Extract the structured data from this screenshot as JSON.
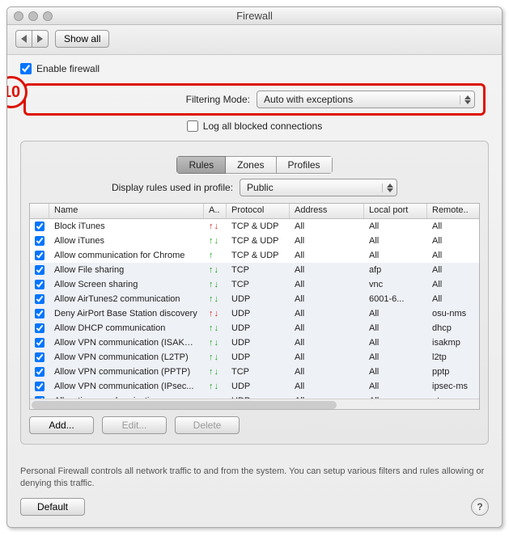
{
  "window": {
    "title": "Firewall"
  },
  "toolbar": {
    "show_all": "Show all"
  },
  "main": {
    "enable_label": "Enable firewall",
    "filtering_label": "Filtering Mode:",
    "filtering_value": "Auto with exceptions",
    "log_label": "Log all blocked connections",
    "annotation_number": "10"
  },
  "tabs": {
    "rules": "Rules",
    "zones": "Zones",
    "profiles": "Profiles"
  },
  "profile": {
    "label": "Display rules used in profile:",
    "value": "Public"
  },
  "columns": {
    "name": "Name",
    "action": "A..",
    "protocol": "Protocol",
    "address": "Address",
    "localport": "Local port",
    "remoteport": "Remote.."
  },
  "rows": [
    {
      "name": "Block iTunes",
      "action": "deny",
      "protocol": "TCP & UDP",
      "address": "All",
      "localport": "All",
      "remoteport": "All",
      "striped": false
    },
    {
      "name": "Allow iTunes",
      "action": "allow",
      "protocol": "TCP & UDP",
      "address": "All",
      "localport": "All",
      "remoteport": "All",
      "striped": false
    },
    {
      "name": "Allow communication for Chrome",
      "action": "allow-up",
      "protocol": "TCP & UDP",
      "address": "All",
      "localport": "All",
      "remoteport": "All",
      "striped": false
    },
    {
      "name": "Allow File sharing",
      "action": "allow",
      "protocol": "TCP",
      "address": "All",
      "localport": "afp",
      "remoteport": "All",
      "striped": true
    },
    {
      "name": "Allow Screen sharing",
      "action": "allow",
      "protocol": "TCP",
      "address": "All",
      "localport": "vnc",
      "remoteport": "All",
      "striped": true
    },
    {
      "name": "Allow AirTunes2 communication",
      "action": "allow",
      "protocol": "UDP",
      "address": "All",
      "localport": "6001-6...",
      "remoteport": "All",
      "striped": true
    },
    {
      "name": "Deny AirPort Base Station discovery",
      "action": "deny",
      "protocol": "UDP",
      "address": "All",
      "localport": "All",
      "remoteport": "osu-nms",
      "striped": true
    },
    {
      "name": "Allow DHCP communication",
      "action": "allow",
      "protocol": "UDP",
      "address": "All",
      "localport": "All",
      "remoteport": "dhcp",
      "striped": true
    },
    {
      "name": "Allow VPN communication (ISAKM...",
      "action": "allow",
      "protocol": "UDP",
      "address": "All",
      "localport": "All",
      "remoteport": "isakmp",
      "striped": true
    },
    {
      "name": "Allow VPN communication (L2TP)",
      "action": "allow",
      "protocol": "UDP",
      "address": "All",
      "localport": "All",
      "remoteport": "l2tp",
      "striped": true
    },
    {
      "name": "Allow VPN communication (PPTP)",
      "action": "allow",
      "protocol": "TCP",
      "address": "All",
      "localport": "All",
      "remoteport": "pptp",
      "striped": true
    },
    {
      "name": "Allow VPN communication (IPsec...",
      "action": "allow",
      "protocol": "UDP",
      "address": "All",
      "localport": "All",
      "remoteport": "ipsec-ms",
      "striped": true
    },
    {
      "name": "Allow time synchronization",
      "action": "allow",
      "protocol": "UDP",
      "address": "All",
      "localport": "All",
      "remoteport": "ntp",
      "striped": true
    }
  ],
  "actions": {
    "add": "Add...",
    "edit": "Edit...",
    "delete": "Delete"
  },
  "footer": {
    "text": "Personal Firewall controls all network traffic to and from the system. You can setup various filters and rules allowing or denying this traffic.",
    "default": "Default",
    "help": "?"
  }
}
